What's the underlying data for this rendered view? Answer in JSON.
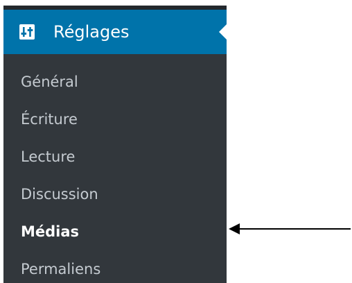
{
  "sidebar": {
    "header": {
      "title": "Réglages",
      "icon": "settings-sliders-icon"
    },
    "items": [
      {
        "label": "Général",
        "current": false
      },
      {
        "label": "Écriture",
        "current": false
      },
      {
        "label": "Lecture",
        "current": false
      },
      {
        "label": "Discussion",
        "current": false
      },
      {
        "label": "Médias",
        "current": true
      },
      {
        "label": "Permaliens",
        "current": false
      }
    ]
  },
  "annotation": {
    "icon": "arrow-left-icon",
    "points_to": "Médias"
  },
  "colors": {
    "header_bg": "#0073aa",
    "sidebar_bg": "#32373c",
    "top_strip": "#23282d",
    "menu_text": "#c5cbd1",
    "current_text": "#ffffff"
  }
}
